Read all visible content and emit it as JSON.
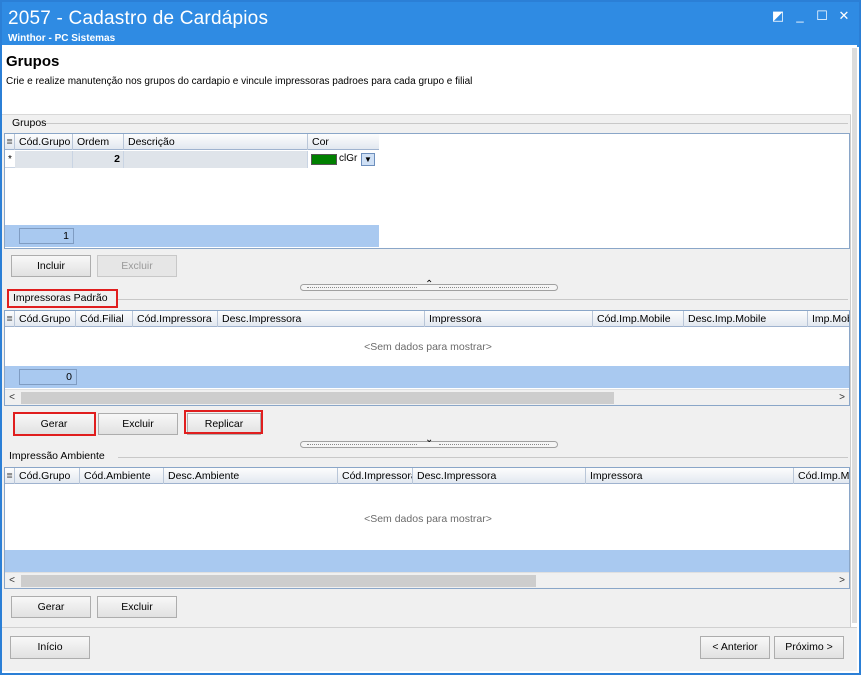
{
  "window": {
    "title": "2057 - Cadastro de Cardápios",
    "subtitle": "Winthor - PC Sistemas",
    "controls": {
      "restore": "◩",
      "minimize": "_",
      "maximize": "☐",
      "close": "✕"
    }
  },
  "header": {
    "title": "Grupos",
    "description": "Crie e realize manutenção nos grupos do cardapio e vincule impressoras padroes para cada grupo e filial"
  },
  "grupos": {
    "label": "Grupos",
    "columns": [
      "Cód.Grupo",
      "Ordem",
      "Descrição",
      "Cor"
    ],
    "new_row": {
      "indicator": "*",
      "ordem": "2",
      "cor": "clGr",
      "cor_hex": "#008000"
    },
    "count": "1",
    "buttons": {
      "incluir": "Incluir",
      "excluir": "Excluir"
    }
  },
  "impressoras": {
    "label": "Impressoras Padrão",
    "columns": [
      "Cód.Grupo",
      "Cód.Filial",
      "Cód.Impressora",
      "Desc.Impressora",
      "Impressora",
      "Cód.Imp.Mobile",
      "Desc.Imp.Mobile",
      "Imp.Mob"
    ],
    "empty_text": "<Sem dados para mostrar>",
    "count": "0",
    "buttons": {
      "gerar": "Gerar",
      "excluir": "Excluir",
      "replicar": "Replicar"
    }
  },
  "ambiente": {
    "label": "Impressão  Ambiente",
    "columns": [
      "Cód.Grupo",
      "Cód.Ambiente",
      "Desc.Ambiente",
      "Cód.Impressora",
      "Desc.Impressora",
      "Impressora",
      "Cód.Imp.M"
    ],
    "empty_text": "<Sem dados para mostrar>",
    "buttons": {
      "gerar": "Gerar",
      "excluir": "Excluir"
    }
  },
  "splitter_icons": {
    "up": "⌃",
    "down": "⌄"
  },
  "scroll_icons": {
    "left": "<",
    "right": ">"
  },
  "nav": {
    "inicio": "Início",
    "anterior": "< Anterior",
    "proximo": "Próximo >"
  },
  "colors": {
    "titlebar": "#2f8be3",
    "highlight": "#e01e1e",
    "grid_footer": "#a9c9f0"
  }
}
